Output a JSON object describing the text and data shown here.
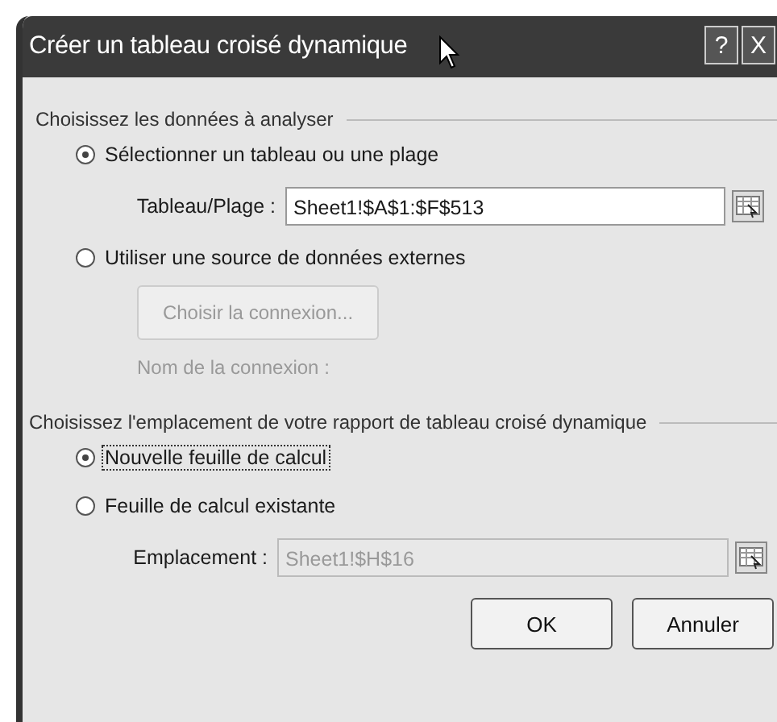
{
  "window": {
    "title": "Créer un tableau croisé dynamique",
    "buttons": [
      {
        "label": "?"
      },
      {
        "label": "X"
      }
    ]
  },
  "data_section": {
    "legend": "Choisissez les données à analyser",
    "options": [
      {
        "label": "Sélectionner un tableau ou une plage",
        "selected": true,
        "focused": false
      },
      {
        "label": "Utiliser une source de données externes",
        "selected": false,
        "focused": false
      }
    ],
    "range_field": {
      "label": "Tableau/Plage :",
      "value": "Sheet1!$A$1:$F$513",
      "disabled": false
    },
    "connection_button": {
      "label": "Choisir la connexion...",
      "disabled": true
    },
    "connection_name": {
      "label": "Nom de la connexion :",
      "disabled": true
    }
  },
  "location_section": {
    "legend": "Choisissez l'emplacement de votre rapport de tableau croisé dynamique",
    "options": [
      {
        "label": "Nouvelle feuille de calcul",
        "selected": true,
        "focused": true
      },
      {
        "label": "Feuille de calcul existante",
        "selected": false,
        "focused": false
      }
    ],
    "location_field": {
      "label": "Emplacement :",
      "value": "Sheet1!$H$16",
      "disabled": true
    }
  },
  "buttons": [
    {
      "label": "OK"
    },
    {
      "label": "Annuler"
    }
  ]
}
